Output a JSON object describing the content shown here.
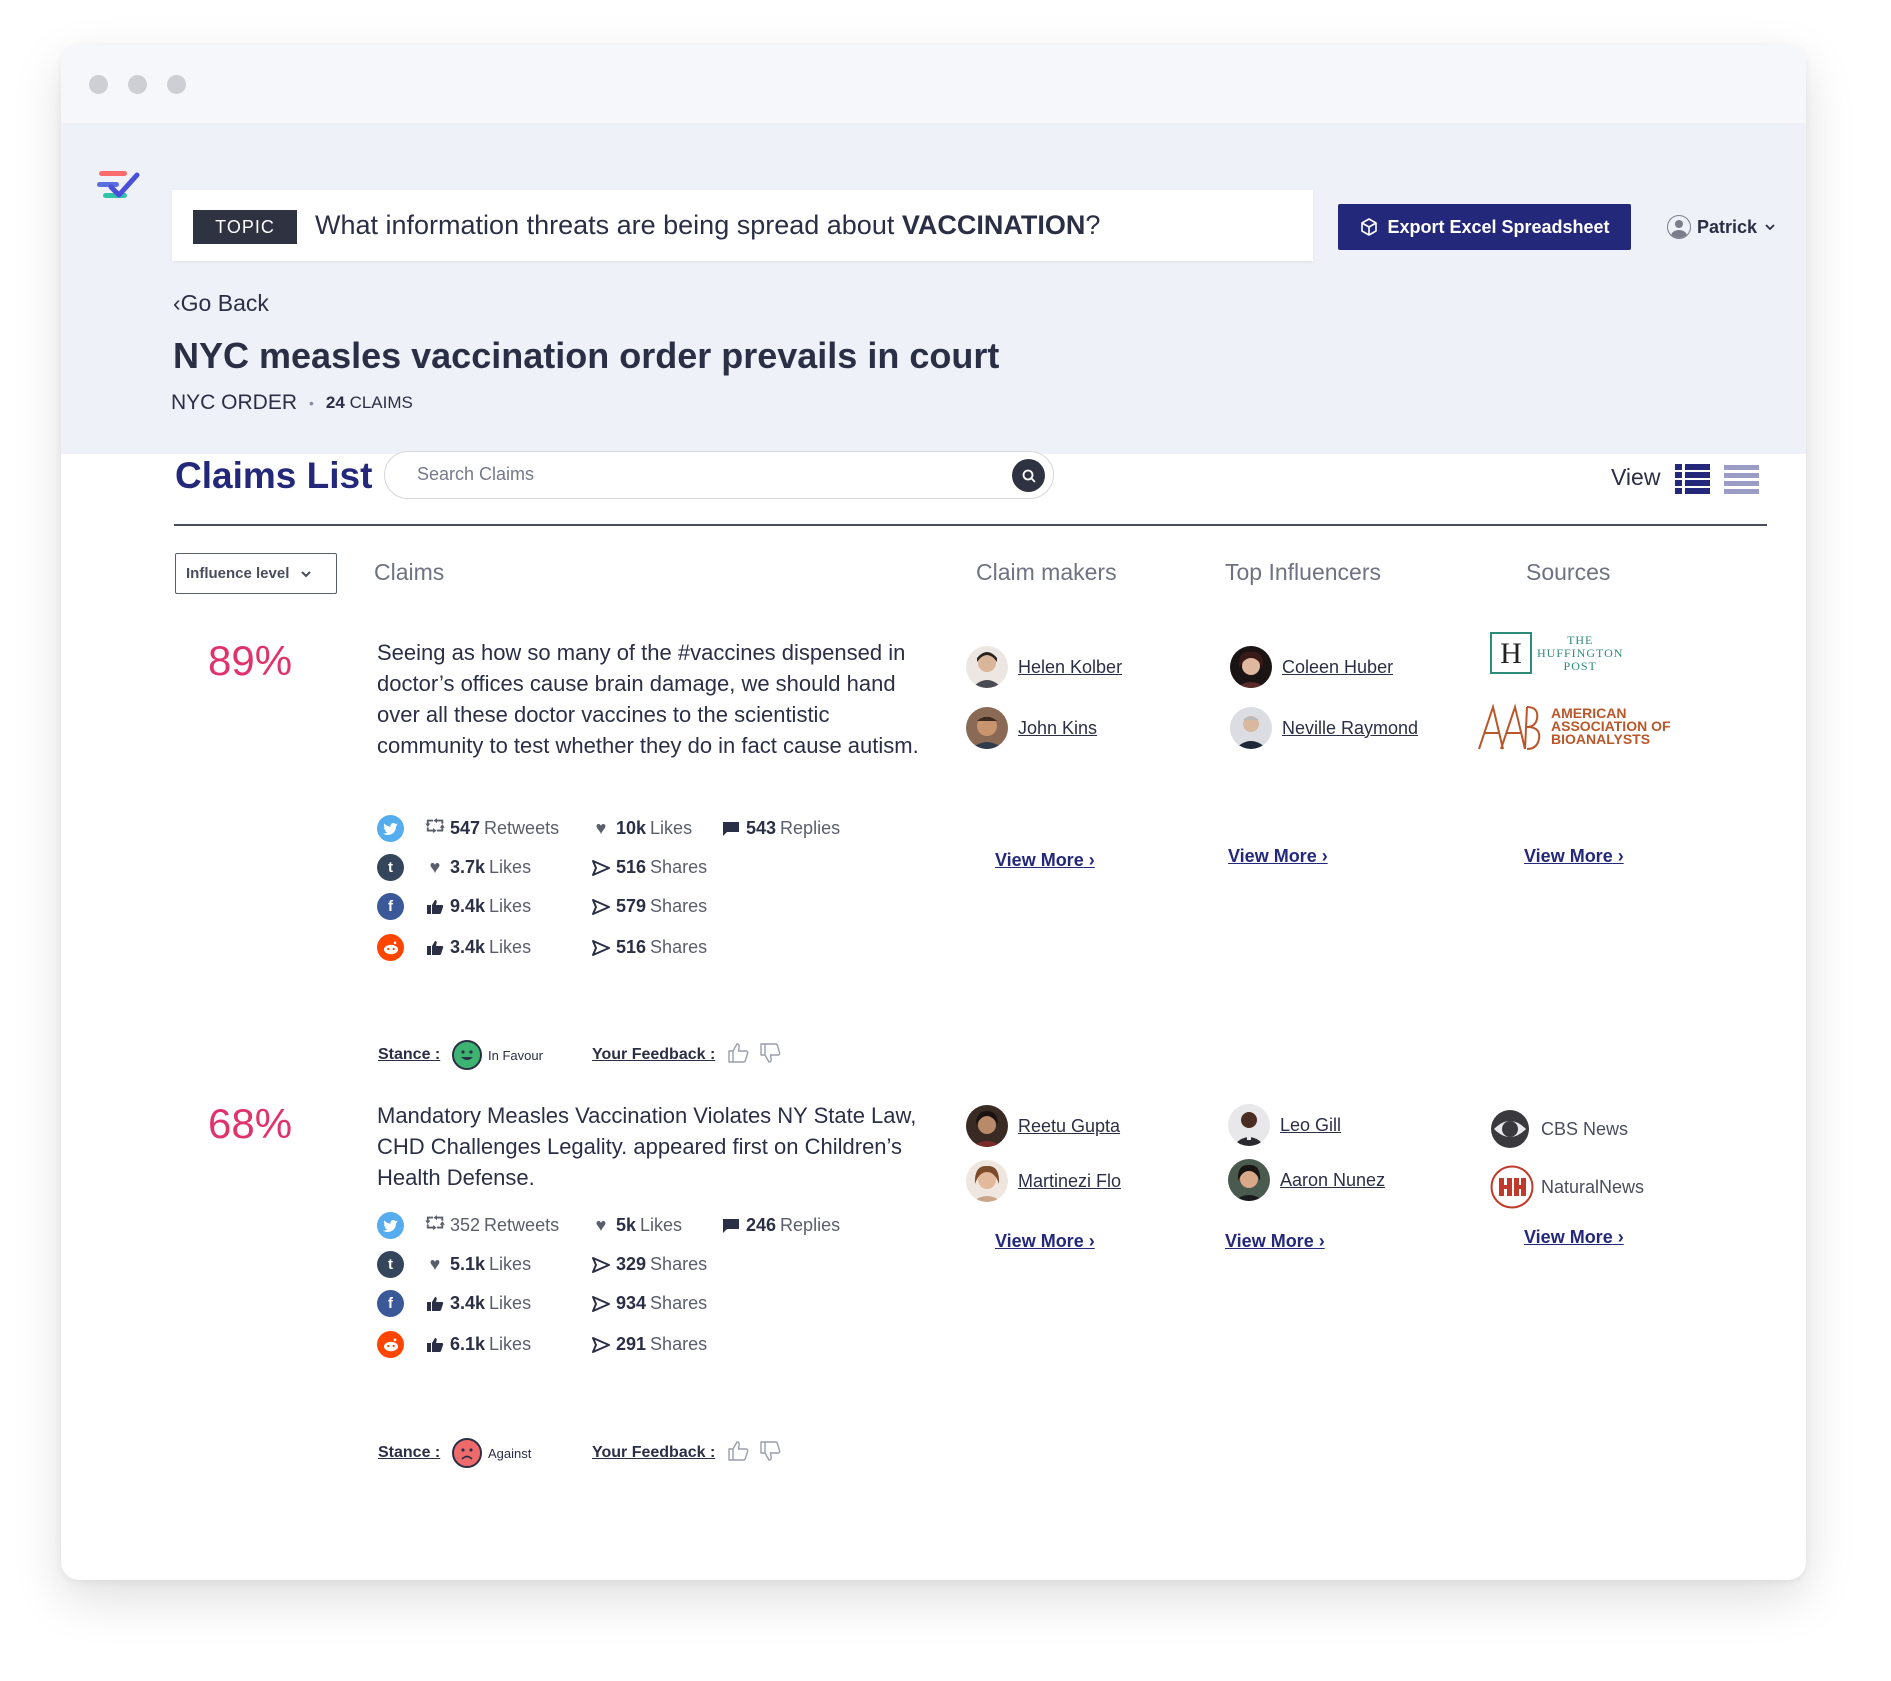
{
  "header": {
    "topic_badge": "TOPIC",
    "question_prefix": "What information threats are being spread about ",
    "question_subject": "VACCINATION",
    "question_suffix": "?",
    "export_label": "Export Excel Spreadsheet",
    "user_name": "Patrick",
    "go_back": "Go Back",
    "page_title": "NYC measles vaccination order prevails in court",
    "collection_name": "NYC ORDER",
    "claims_count": "24",
    "claims_count_label": "CLAIMS"
  },
  "claims_list": {
    "title": "Claims List",
    "search_placeholder": "Search Claims",
    "view_label": "View",
    "filter_label": "Influence level",
    "columns": [
      "Claims",
      "Claim makers",
      "Top Influencers",
      "Sources"
    ]
  },
  "labels": {
    "stance": "Stance :",
    "feedback": "Your Feedback :",
    "view_more": "View More"
  },
  "claims": [
    {
      "score": "89%",
      "text": "Seeing as how so many of the #vaccines dispensed in doctor’s offices cause brain damage, we should hand over all these doctor vaccines to the scientistic community to test whether they do in fact cause autism.",
      "twitter": {
        "retweets": "547",
        "retweets_label": "Retweets",
        "likes": "10k",
        "likes_label": "Likes",
        "replies": "543",
        "replies_label": "Replies"
      },
      "tumblr": {
        "likes": "3.7k",
        "likes_label": "Likes",
        "shares": "516",
        "shares_label": "Shares"
      },
      "facebook": {
        "likes": "9.4k",
        "likes_label": "Likes",
        "shares": "579",
        "shares_label": "Shares"
      },
      "reddit": {
        "likes": "3.4k",
        "likes_label": "Likes",
        "shares": "516",
        "shares_label": "Shares"
      },
      "stance": "In Favour",
      "claim_makers": [
        "Helen Kolber",
        "John Kins"
      ],
      "influencers": [
        "Coleen Huber",
        "Neville Raymond"
      ],
      "sources": [
        {
          "logo_lines": [
            "THE",
            "HUFFINGTON",
            "POST"
          ]
        },
        {
          "logo_lines": [
            "AMERICAN",
            "ASSOCIATION OF",
            "BIOANALYSTS"
          ]
        }
      ]
    },
    {
      "score": "68%",
      "text": "Mandatory Measles Vaccination Violates NY State Law, CHD Challenges Legality. appeared first on Children’s Health Defense.",
      "twitter": {
        "retweets": "352",
        "retweets_label": "Retweets",
        "likes": "5k",
        "likes_label": "Likes",
        "replies": "246",
        "replies_label": "Replies"
      },
      "tumblr": {
        "likes": "5.1k",
        "likes_label": "Likes",
        "shares": "329",
        "shares_label": "Shares"
      },
      "facebook": {
        "likes": "3.4k",
        "likes_label": "Likes",
        "shares": "934",
        "shares_label": "Shares"
      },
      "reddit": {
        "likes": "6.1k",
        "likes_label": "Likes",
        "shares": "291",
        "shares_label": "Shares"
      },
      "stance": "Against",
      "claim_makers": [
        "Reetu Gupta",
        "Martinezi Flo"
      ],
      "influencers": [
        "Leo Gill",
        "Aaron Nunez"
      ],
      "sources": [
        {
          "name": "CBS News"
        },
        {
          "name": "NaturalNews"
        }
      ]
    }
  ],
  "colors": {
    "brand_navy": "#23287a",
    "score_pink": "#e0336b",
    "twitter": "#55acee",
    "tumblr": "#35465c",
    "facebook": "#3b5998",
    "reddit": "#ff4500",
    "favour_green": "#3cb371",
    "against_red": "#ef6b6b"
  },
  "icons": [
    "logo-icon",
    "export-cube-icon",
    "user-icon",
    "chevron-down-icon",
    "search-icon",
    "list-view-icon",
    "compact-view-icon",
    "twitter-icon",
    "tumblr-icon",
    "facebook-icon",
    "reddit-icon",
    "retweet-icon",
    "heart-icon",
    "reply-icon",
    "thumbs-up-icon",
    "share-icon",
    "thumbs-down-icon"
  ]
}
